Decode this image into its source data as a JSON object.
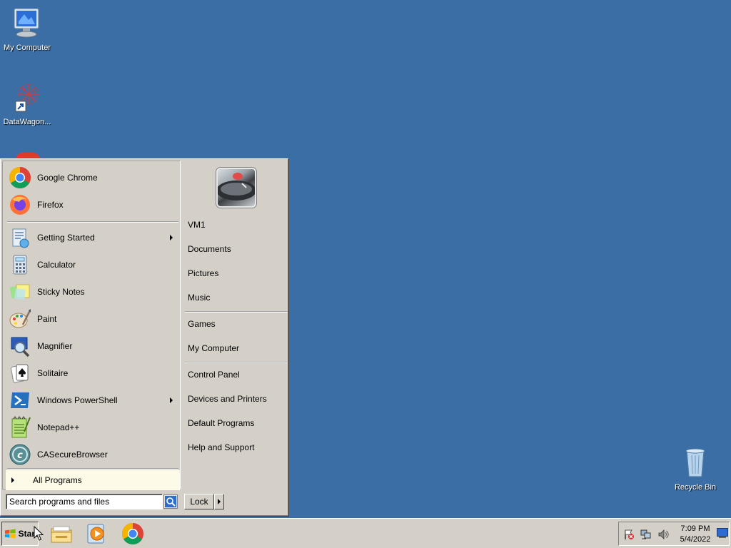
{
  "desktop": {
    "icons": [
      {
        "label": "My Computer"
      },
      {
        "label": "DataWagon..."
      },
      {
        "label": "Recycle Bin"
      }
    ]
  },
  "start_menu": {
    "pinned": [
      {
        "label": "Google Chrome",
        "icon": "chrome-icon"
      },
      {
        "label": "Firefox",
        "icon": "firefox-icon"
      }
    ],
    "recent": [
      {
        "label": "Getting Started",
        "icon": "getting-started-icon",
        "submenu": true
      },
      {
        "label": "Calculator",
        "icon": "calculator-icon"
      },
      {
        "label": "Sticky Notes",
        "icon": "sticky-notes-icon"
      },
      {
        "label": "Paint",
        "icon": "paint-icon"
      },
      {
        "label": "Magnifier",
        "icon": "magnifier-icon"
      },
      {
        "label": "Solitaire",
        "icon": "solitaire-icon"
      },
      {
        "label": "Windows PowerShell",
        "icon": "powershell-icon",
        "submenu": true
      },
      {
        "label": "Notepad++",
        "icon": "notepadpp-icon"
      },
      {
        "label": "CASecureBrowser",
        "icon": "casecurebrowser-icon"
      }
    ],
    "all_programs": "All Programs",
    "search_placeholder": "Search programs and files",
    "right_items": [
      {
        "label": "VM1"
      },
      {
        "label": "Documents"
      },
      {
        "label": "Pictures"
      },
      {
        "label": "Music"
      },
      {
        "label": "Games"
      },
      {
        "label": "My Computer"
      },
      {
        "label": "Control Panel"
      },
      {
        "label": "Devices and Printers"
      },
      {
        "label": "Default Programs"
      },
      {
        "label": "Help and Support"
      }
    ],
    "lock_label": "Lock"
  },
  "taskbar": {
    "start_label": "Start",
    "clock": {
      "time": "7:09 PM",
      "date": "5/4/2022"
    }
  },
  "colors": {
    "desktop_bg": "#3a6ea5",
    "menu_bg": "#d4d0c8",
    "all_programs_bg": "#fdfbe8"
  }
}
